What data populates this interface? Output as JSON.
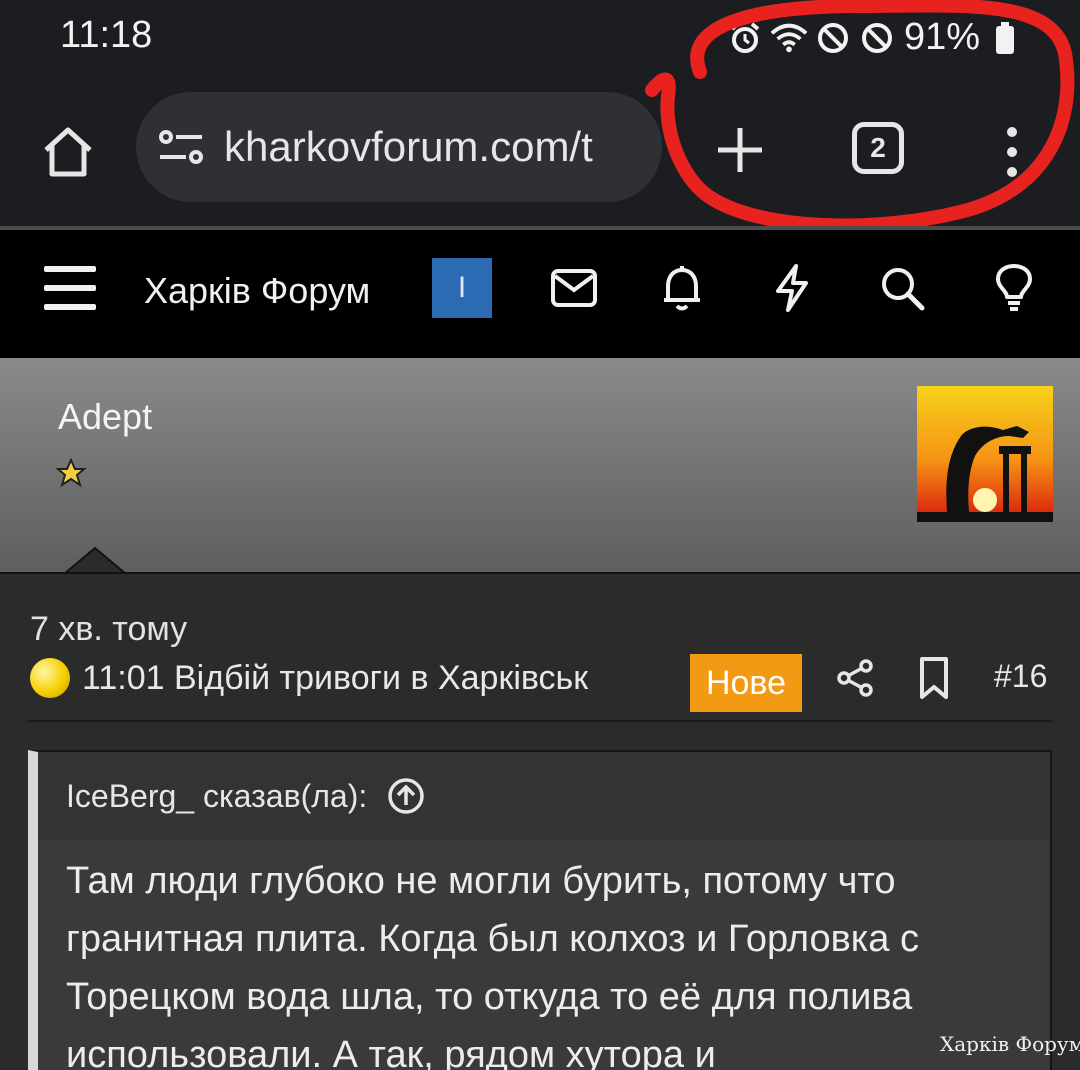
{
  "status_bar": {
    "time": "11:18",
    "battery_percent": "91%",
    "icons": [
      "alarm-icon",
      "wifi-icon",
      "do-not-disturb-icon",
      "block-icon",
      "battery-icon"
    ]
  },
  "browser": {
    "url": "kharkovforum.com/t",
    "tab_count": "2",
    "icons": [
      "home-icon",
      "site-settings-icon",
      "new-tab-icon",
      "tab-switcher-icon",
      "more-menu-icon"
    ]
  },
  "forum_nav": {
    "title": "Харків Форум",
    "user_badge": "I",
    "icons": [
      "menu-icon",
      "mail-icon",
      "bell-icon",
      "lightning-icon",
      "search-icon",
      "lightbulb-icon"
    ],
    "badge_color": "#2d6ab4"
  },
  "user_card": {
    "rank": "Adept"
  },
  "post": {
    "time_ago": "7 хв. тому",
    "title": "11:01 Відбій тривоги в Харківськ",
    "new_badge": "Нове",
    "number": "#16",
    "accent_color": "#f29a14"
  },
  "quote": {
    "author": "IceBerg_ сказав(ла):",
    "text": "Там люди глубоко не могли бурить, потому что гранитная плита. Когда был колхоз и Горловка с Торецком вода шла, то откуда то её для полива использовали. А так, рядом хутора и"
  },
  "watermark": "Харків Форум"
}
